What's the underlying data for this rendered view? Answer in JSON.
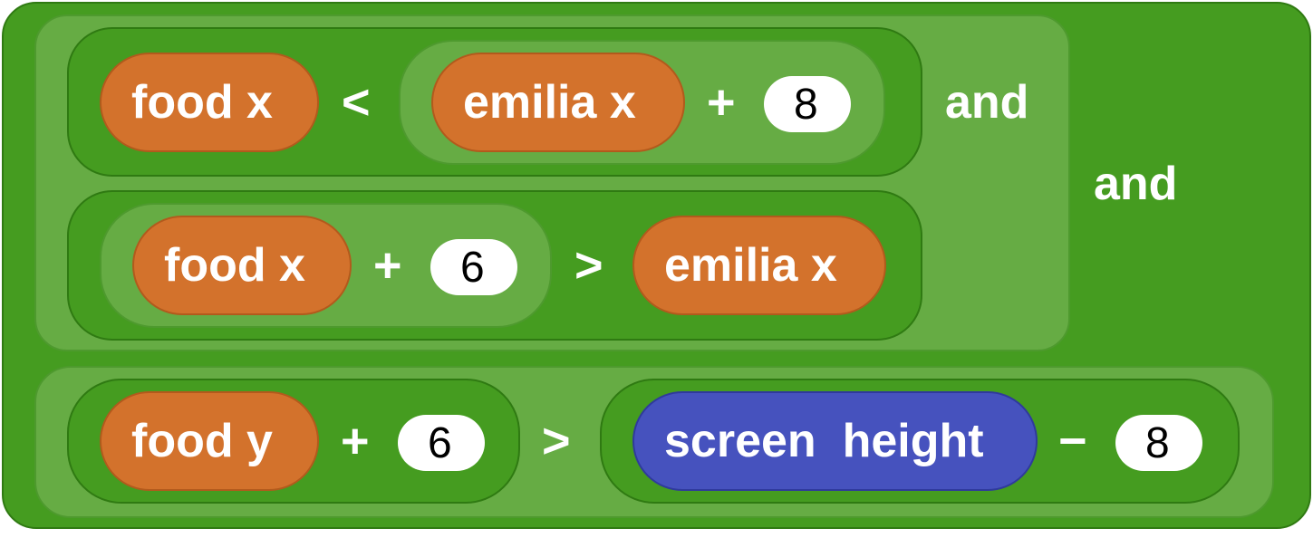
{
  "outer_operator": "and",
  "inner_operator": "and",
  "row1": {
    "left_var": "food x",
    "comparator": "<",
    "right_var": "emilia x",
    "plus": "+",
    "number": "8"
  },
  "row2": {
    "left_var": "food x",
    "plus": "+",
    "number": "6",
    "comparator": ">",
    "right_var": "emilia x"
  },
  "row3": {
    "left_var": "food y",
    "plus": "+",
    "number": "6",
    "comparator": ">",
    "right_var": "screen  height",
    "minus": "−",
    "number2": "8"
  },
  "colors": {
    "operator_green_dark": "#459c20",
    "operator_green_light": "#66ac44",
    "variable_orange": "#d3722c",
    "sensor_blue": "#4652be",
    "number_slot": "#ffffff"
  }
}
